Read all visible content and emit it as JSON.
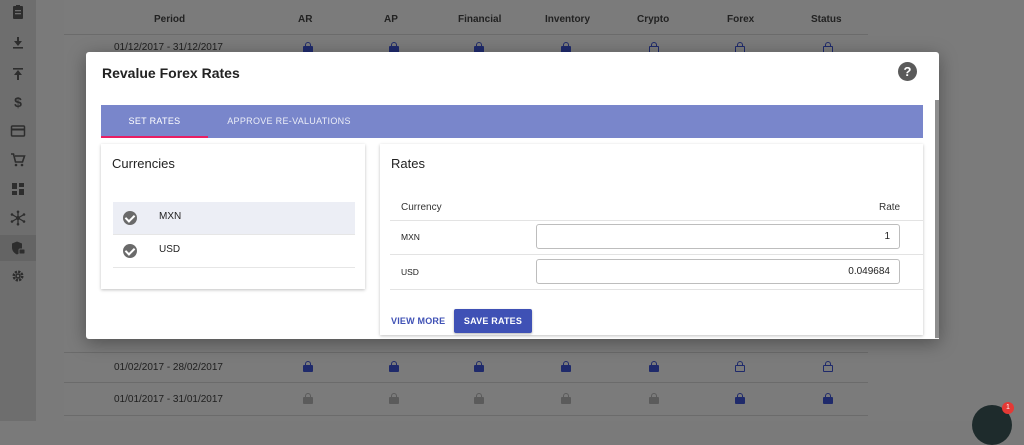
{
  "sidebar": {
    "icons": [
      "clipboard-icon",
      "download-icon",
      "upload-icon",
      "dollar-icon",
      "credit-card-icon",
      "cart-icon",
      "dashboard-icon",
      "network-icon",
      "lock-shield-icon",
      "gear-icon"
    ]
  },
  "background_table": {
    "headers": [
      "Period",
      "AR",
      "AP",
      "Financial",
      "Inventory",
      "Crypto",
      "Forex",
      "Status"
    ],
    "rows": [
      {
        "period": "01/12/2017 - 31/12/2017",
        "locks": [
          "locked",
          "locked",
          "locked",
          "locked",
          "open",
          "open",
          "open"
        ]
      },
      {
        "period": "01/02/2017 - 28/02/2017",
        "locks": [
          "locked",
          "locked",
          "locked",
          "locked",
          "locked",
          "open",
          "open"
        ]
      },
      {
        "period": "01/01/2017 - 31/01/2017",
        "locks": [
          "gray",
          "gray",
          "gray",
          "gray",
          "gray",
          "locked",
          "locked"
        ]
      }
    ]
  },
  "modal": {
    "title": "Revalue Forex Rates",
    "help_icon": "help-circle-icon",
    "tabs": [
      {
        "label": "SET RATES",
        "active": true
      },
      {
        "label": "APPROVE RE-VALUATIONS",
        "active": false
      }
    ],
    "currencies_card": {
      "title": "Currencies",
      "items": [
        {
          "label": "MXN",
          "checked": true,
          "selected": true
        },
        {
          "label": "USD",
          "checked": true,
          "selected": false
        }
      ]
    },
    "rates_card": {
      "title": "Rates",
      "col_currency": "Currency",
      "col_rate": "Rate",
      "rows": [
        {
          "currency": "MXN",
          "rate": "1"
        },
        {
          "currency": "USD",
          "rate": "0.049684"
        }
      ],
      "view_more_label": "VIEW MORE",
      "save_label": "SAVE RATES"
    }
  },
  "chat": {
    "badge_count": "1"
  },
  "colors": {
    "primary": "#3f51b5",
    "tab_bar": "#7986cb",
    "tab_indicator": "#e91e63"
  }
}
